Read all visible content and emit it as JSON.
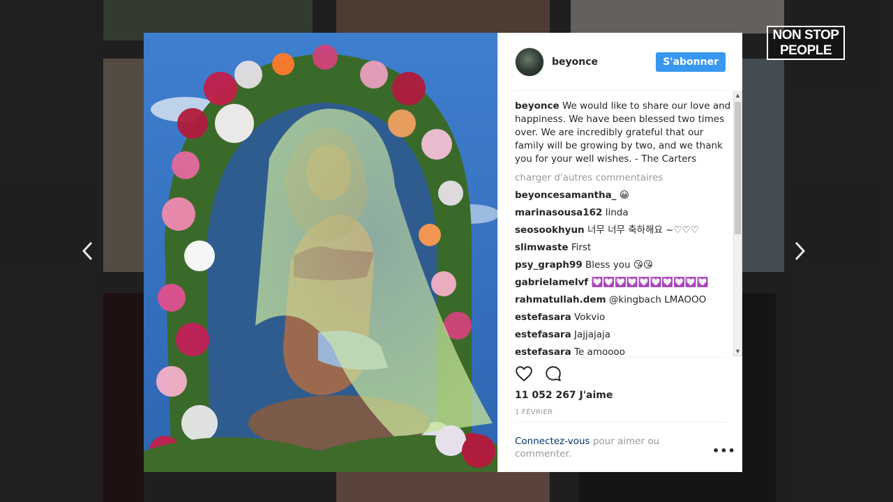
{
  "watermark": {
    "line1": "NON STOP",
    "line2": "PEOPLE"
  },
  "post": {
    "username": "beyonce",
    "follow_label": "S'abonner",
    "caption_user": "beyonce",
    "caption_text": " We would like to share our love and happiness. We have been blessed two times over. We are incredibly grateful that our family will be growing by two, and we thank you for your well wishes. - The Carters",
    "load_more": "charger d'autres commentaires",
    "comments": [
      {
        "user": "beyoncesamantha_",
        "text": "😀"
      },
      {
        "user": "marinasousa162",
        "text": "linda"
      },
      {
        "user": "seosookhyun",
        "text": "너무 너무 축하해요 ~♡♡♡"
      },
      {
        "user": "slimwaste",
        "text": "First"
      },
      {
        "user": "psy_graph99",
        "text": "Bless you 😘😘"
      },
      {
        "user": "gabrielamelvf",
        "text": "💟💟💟💟💟💟💟💟💟💟"
      },
      {
        "user": "rahmatullah.dem",
        "text": "@kingbach LMAOOO"
      },
      {
        "user": "estefasara",
        "text": "Vokvio"
      },
      {
        "user": "estefasara",
        "text": "Jajjajaja"
      },
      {
        "user": "estefasara",
        "text": "Te amoooo"
      }
    ],
    "likes": "11 052 267 J'aime",
    "date": "1 FÉVRIER",
    "login_link": "Connectez-vous",
    "login_text": " pour aimer ou commenter.",
    "more_label": "•••"
  },
  "icons": {
    "like": "heart-icon",
    "comment": "comment-bubble-icon",
    "prev": "chevron-left-icon",
    "next": "chevron-right-icon",
    "more": "more-dots-icon"
  },
  "colors": {
    "follow_button": "#3897f0",
    "link": "#003569",
    "muted": "#999999"
  }
}
